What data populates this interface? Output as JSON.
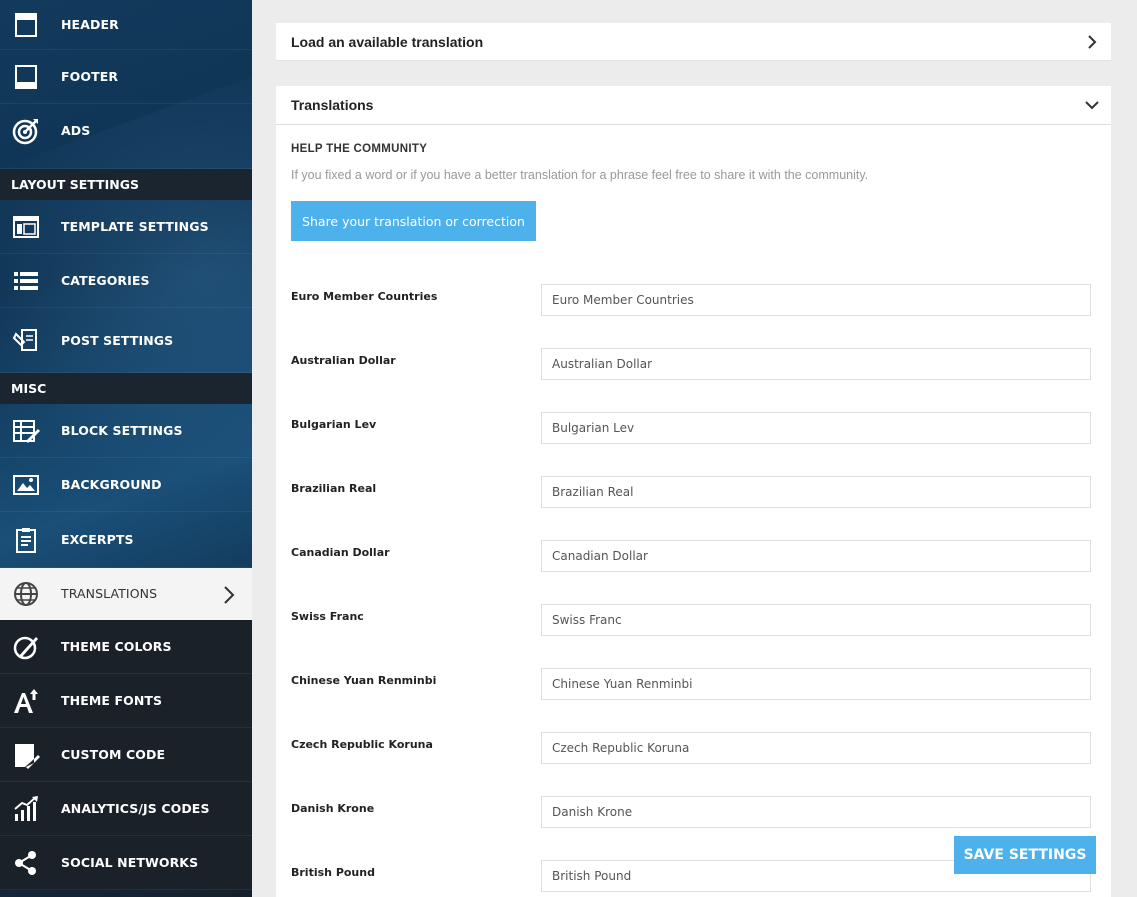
{
  "sidebar": {
    "items_top": [
      {
        "label": "HEADER",
        "icon": "header-icon"
      },
      {
        "label": "FOOTER",
        "icon": "footer-icon"
      },
      {
        "label": "ADS",
        "icon": "target-icon"
      }
    ],
    "section_layout": "LAYOUT SETTINGS",
    "items_layout": [
      {
        "label": "TEMPLATE SETTINGS",
        "icon": "template-icon"
      },
      {
        "label": "CATEGORIES",
        "icon": "list-icon"
      },
      {
        "label": "POST SETTINGS",
        "icon": "post-settings-icon"
      }
    ],
    "section_misc": "MISC",
    "items_misc": [
      {
        "label": "BLOCK SETTINGS",
        "icon": "block-settings-icon"
      },
      {
        "label": "BACKGROUND",
        "icon": "image-icon"
      },
      {
        "label": "EXCERPTS",
        "icon": "clipboard-icon"
      },
      {
        "label": "TRANSLATIONS",
        "icon": "globe-icon"
      },
      {
        "label": "THEME COLORS",
        "icon": "brush-icon"
      },
      {
        "label": "THEME FONTS",
        "icon": "font-icon"
      },
      {
        "label": "CUSTOM CODE",
        "icon": "code-icon"
      },
      {
        "label": "ANALYTICS/JS CODES",
        "icon": "analytics-icon"
      },
      {
        "label": "SOCIAL NETWORKS",
        "icon": "share-icon"
      }
    ]
  },
  "load_panel": {
    "title": "Load an available translation"
  },
  "translations_panel": {
    "title": "Translations",
    "help_title": "HELP THE COMMUNITY",
    "help_text": "If you fixed a word or if you have a better translation for a phrase feel free to share it with the community.",
    "share_button": "Share your translation or correction",
    "rows": [
      {
        "label": "Euro Member Countries",
        "value": "Euro Member Countries"
      },
      {
        "label": "Australian Dollar",
        "value": "Australian Dollar"
      },
      {
        "label": "Bulgarian Lev",
        "value": "Bulgarian Lev"
      },
      {
        "label": "Brazilian Real",
        "value": "Brazilian Real"
      },
      {
        "label": "Canadian Dollar",
        "value": "Canadian Dollar"
      },
      {
        "label": "Swiss Franc",
        "value": "Swiss Franc"
      },
      {
        "label": "Chinese Yuan Renminbi",
        "value": "Chinese Yuan Renminbi"
      },
      {
        "label": "Czech Republic Koruna",
        "value": "Czech Republic Koruna"
      },
      {
        "label": "Danish Krone",
        "value": "Danish Krone"
      },
      {
        "label": "British Pound",
        "value": "British Pound"
      }
    ]
  },
  "save_button": "SAVE SETTINGS",
  "colors": {
    "accent": "#4db2ec",
    "sidebar_dark": "#1a2129"
  }
}
